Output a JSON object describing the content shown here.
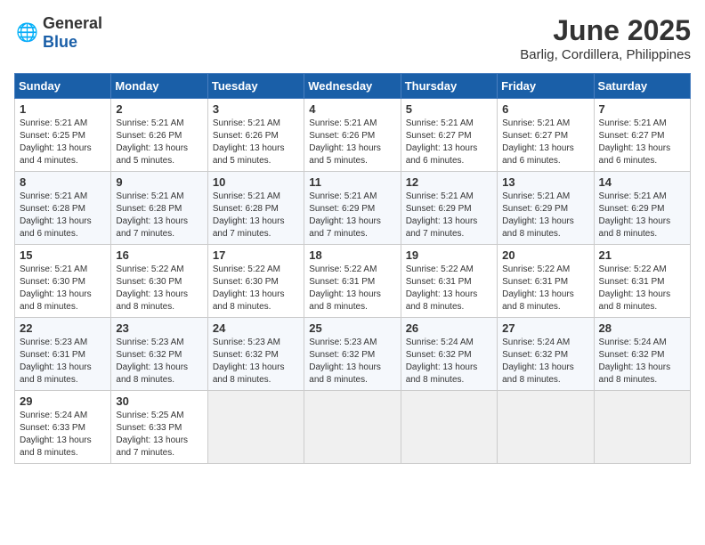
{
  "logo": {
    "general": "General",
    "blue": "Blue"
  },
  "title": {
    "month": "June 2025",
    "location": "Barlig, Cordillera, Philippines"
  },
  "weekdays": [
    "Sunday",
    "Monday",
    "Tuesday",
    "Wednesday",
    "Thursday",
    "Friday",
    "Saturday"
  ],
  "weeks": [
    [
      {
        "day": "1",
        "sunrise": "5:21 AM",
        "sunset": "6:25 PM",
        "daylight": "13 hours and 4 minutes."
      },
      {
        "day": "2",
        "sunrise": "5:21 AM",
        "sunset": "6:26 PM",
        "daylight": "13 hours and 5 minutes."
      },
      {
        "day": "3",
        "sunrise": "5:21 AM",
        "sunset": "6:26 PM",
        "daylight": "13 hours and 5 minutes."
      },
      {
        "day": "4",
        "sunrise": "5:21 AM",
        "sunset": "6:26 PM",
        "daylight": "13 hours and 5 minutes."
      },
      {
        "day": "5",
        "sunrise": "5:21 AM",
        "sunset": "6:27 PM",
        "daylight": "13 hours and 6 minutes."
      },
      {
        "day": "6",
        "sunrise": "5:21 AM",
        "sunset": "6:27 PM",
        "daylight": "13 hours and 6 minutes."
      },
      {
        "day": "7",
        "sunrise": "5:21 AM",
        "sunset": "6:27 PM",
        "daylight": "13 hours and 6 minutes."
      }
    ],
    [
      {
        "day": "8",
        "sunrise": "5:21 AM",
        "sunset": "6:28 PM",
        "daylight": "13 hours and 6 minutes."
      },
      {
        "day": "9",
        "sunrise": "5:21 AM",
        "sunset": "6:28 PM",
        "daylight": "13 hours and 7 minutes."
      },
      {
        "day": "10",
        "sunrise": "5:21 AM",
        "sunset": "6:28 PM",
        "daylight": "13 hours and 7 minutes."
      },
      {
        "day": "11",
        "sunrise": "5:21 AM",
        "sunset": "6:29 PM",
        "daylight": "13 hours and 7 minutes."
      },
      {
        "day": "12",
        "sunrise": "5:21 AM",
        "sunset": "6:29 PM",
        "daylight": "13 hours and 7 minutes."
      },
      {
        "day": "13",
        "sunrise": "5:21 AM",
        "sunset": "6:29 PM",
        "daylight": "13 hours and 8 minutes."
      },
      {
        "day": "14",
        "sunrise": "5:21 AM",
        "sunset": "6:29 PM",
        "daylight": "13 hours and 8 minutes."
      }
    ],
    [
      {
        "day": "15",
        "sunrise": "5:21 AM",
        "sunset": "6:30 PM",
        "daylight": "13 hours and 8 minutes."
      },
      {
        "day": "16",
        "sunrise": "5:22 AM",
        "sunset": "6:30 PM",
        "daylight": "13 hours and 8 minutes."
      },
      {
        "day": "17",
        "sunrise": "5:22 AM",
        "sunset": "6:30 PM",
        "daylight": "13 hours and 8 minutes."
      },
      {
        "day": "18",
        "sunrise": "5:22 AM",
        "sunset": "6:31 PM",
        "daylight": "13 hours and 8 minutes."
      },
      {
        "day": "19",
        "sunrise": "5:22 AM",
        "sunset": "6:31 PM",
        "daylight": "13 hours and 8 minutes."
      },
      {
        "day": "20",
        "sunrise": "5:22 AM",
        "sunset": "6:31 PM",
        "daylight": "13 hours and 8 minutes."
      },
      {
        "day": "21",
        "sunrise": "5:22 AM",
        "sunset": "6:31 PM",
        "daylight": "13 hours and 8 minutes."
      }
    ],
    [
      {
        "day": "22",
        "sunrise": "5:23 AM",
        "sunset": "6:31 PM",
        "daylight": "13 hours and 8 minutes."
      },
      {
        "day": "23",
        "sunrise": "5:23 AM",
        "sunset": "6:32 PM",
        "daylight": "13 hours and 8 minutes."
      },
      {
        "day": "24",
        "sunrise": "5:23 AM",
        "sunset": "6:32 PM",
        "daylight": "13 hours and 8 minutes."
      },
      {
        "day": "25",
        "sunrise": "5:23 AM",
        "sunset": "6:32 PM",
        "daylight": "13 hours and 8 minutes."
      },
      {
        "day": "26",
        "sunrise": "5:24 AM",
        "sunset": "6:32 PM",
        "daylight": "13 hours and 8 minutes."
      },
      {
        "day": "27",
        "sunrise": "5:24 AM",
        "sunset": "6:32 PM",
        "daylight": "13 hours and 8 minutes."
      },
      {
        "day": "28",
        "sunrise": "5:24 AM",
        "sunset": "6:32 PM",
        "daylight": "13 hours and 8 minutes."
      }
    ],
    [
      {
        "day": "29",
        "sunrise": "5:24 AM",
        "sunset": "6:33 PM",
        "daylight": "13 hours and 8 minutes."
      },
      {
        "day": "30",
        "sunrise": "5:25 AM",
        "sunset": "6:33 PM",
        "daylight": "13 hours and 7 minutes."
      },
      null,
      null,
      null,
      null,
      null
    ]
  ]
}
